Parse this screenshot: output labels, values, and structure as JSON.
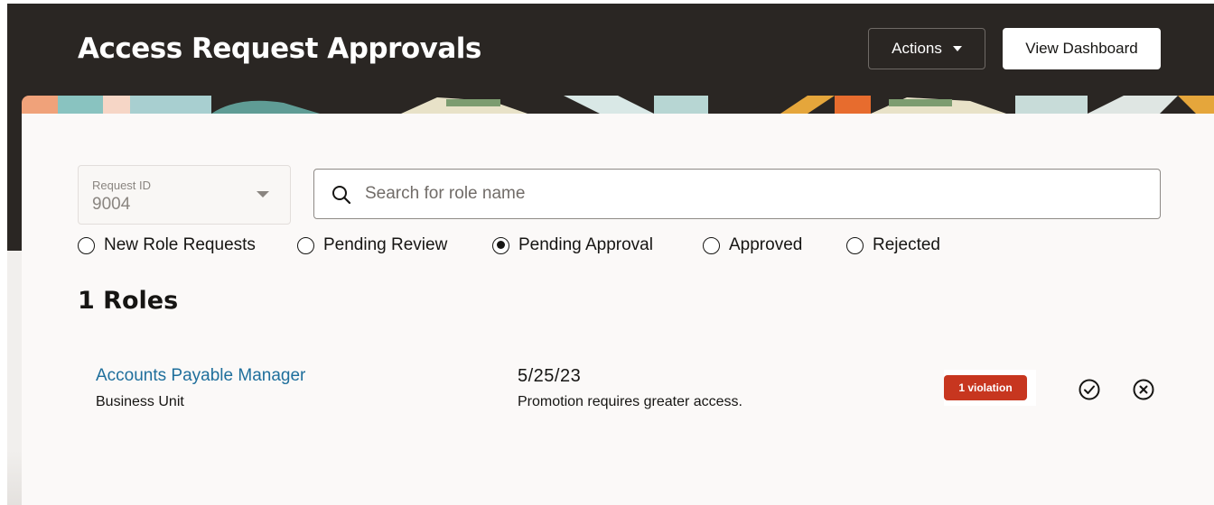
{
  "header": {
    "title": "Access Request Approvals",
    "actions_label": "Actions",
    "dashboard_label": "View Dashboard"
  },
  "filters": {
    "request_select": {
      "label": "Request ID",
      "value": "9004"
    },
    "search": {
      "placeholder": "Search for role name",
      "value": ""
    },
    "status_options": [
      {
        "label": "New Role Requests",
        "checked": false
      },
      {
        "label": "Pending Review",
        "checked": false
      },
      {
        "label": "Pending Approval",
        "checked": true
      },
      {
        "label": "Approved",
        "checked": false
      },
      {
        "label": "Rejected",
        "checked": false
      }
    ]
  },
  "results": {
    "count_label": "1 Roles",
    "rows": [
      {
        "role_name": "Accounts Payable Manager",
        "role_scope": "Business Unit",
        "date": "5/25/23",
        "reason": "Promotion requires greater access.",
        "violation_badge": "1 violation"
      }
    ]
  },
  "icons": {
    "search": "search-icon",
    "approve": "check-circle-icon",
    "reject": "x-circle-icon",
    "dropdown": "caret-down-icon"
  },
  "colors": {
    "header_bg": "#2a2623",
    "card_bg": "#fbf9f8",
    "link": "#1f6f9c",
    "violation": "#c7361f"
  }
}
